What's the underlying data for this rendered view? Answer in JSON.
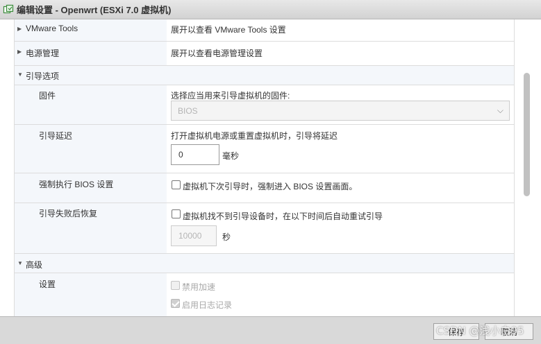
{
  "window": {
    "title": "编辑设置 - Openwrt (ESXi 7.0 虚拟机)"
  },
  "rows": {
    "vmware_tools": {
      "label": "VMware Tools",
      "desc": "展开以查看 VMware Tools 设置"
    },
    "power": {
      "label": "电源管理",
      "desc": "展开以查看电源管理设置"
    },
    "boot_options": {
      "label": "引导选项"
    },
    "firmware": {
      "label": "固件",
      "desc": "选择应当用来引导虚拟机的固件:",
      "selected": "BIOS"
    },
    "boot_delay": {
      "label": "引导延迟",
      "desc": "打开虚拟机电源或重置虚拟机时，引导将延迟",
      "value": "0",
      "unit": "毫秒"
    },
    "force_bios": {
      "label": "强制执行 BIOS 设置",
      "checkbox_label": "虚拟机下次引导时，强制进入 BIOS 设置画面。"
    },
    "boot_failure": {
      "label": "引导失败后恢复",
      "checkbox_label": "虚拟机找不到引导设备时，在以下时间后自动重试引导",
      "value": "10000",
      "unit": "秒"
    },
    "advanced": {
      "label": "高级"
    },
    "settings": {
      "label": "设置",
      "disable_accel": "禁用加速",
      "enable_logging": "启用日志记录"
    }
  },
  "footer": {
    "save_label": "保存",
    "cancel_label": "取消",
    "watermark": "CSDN @浅小白95"
  }
}
